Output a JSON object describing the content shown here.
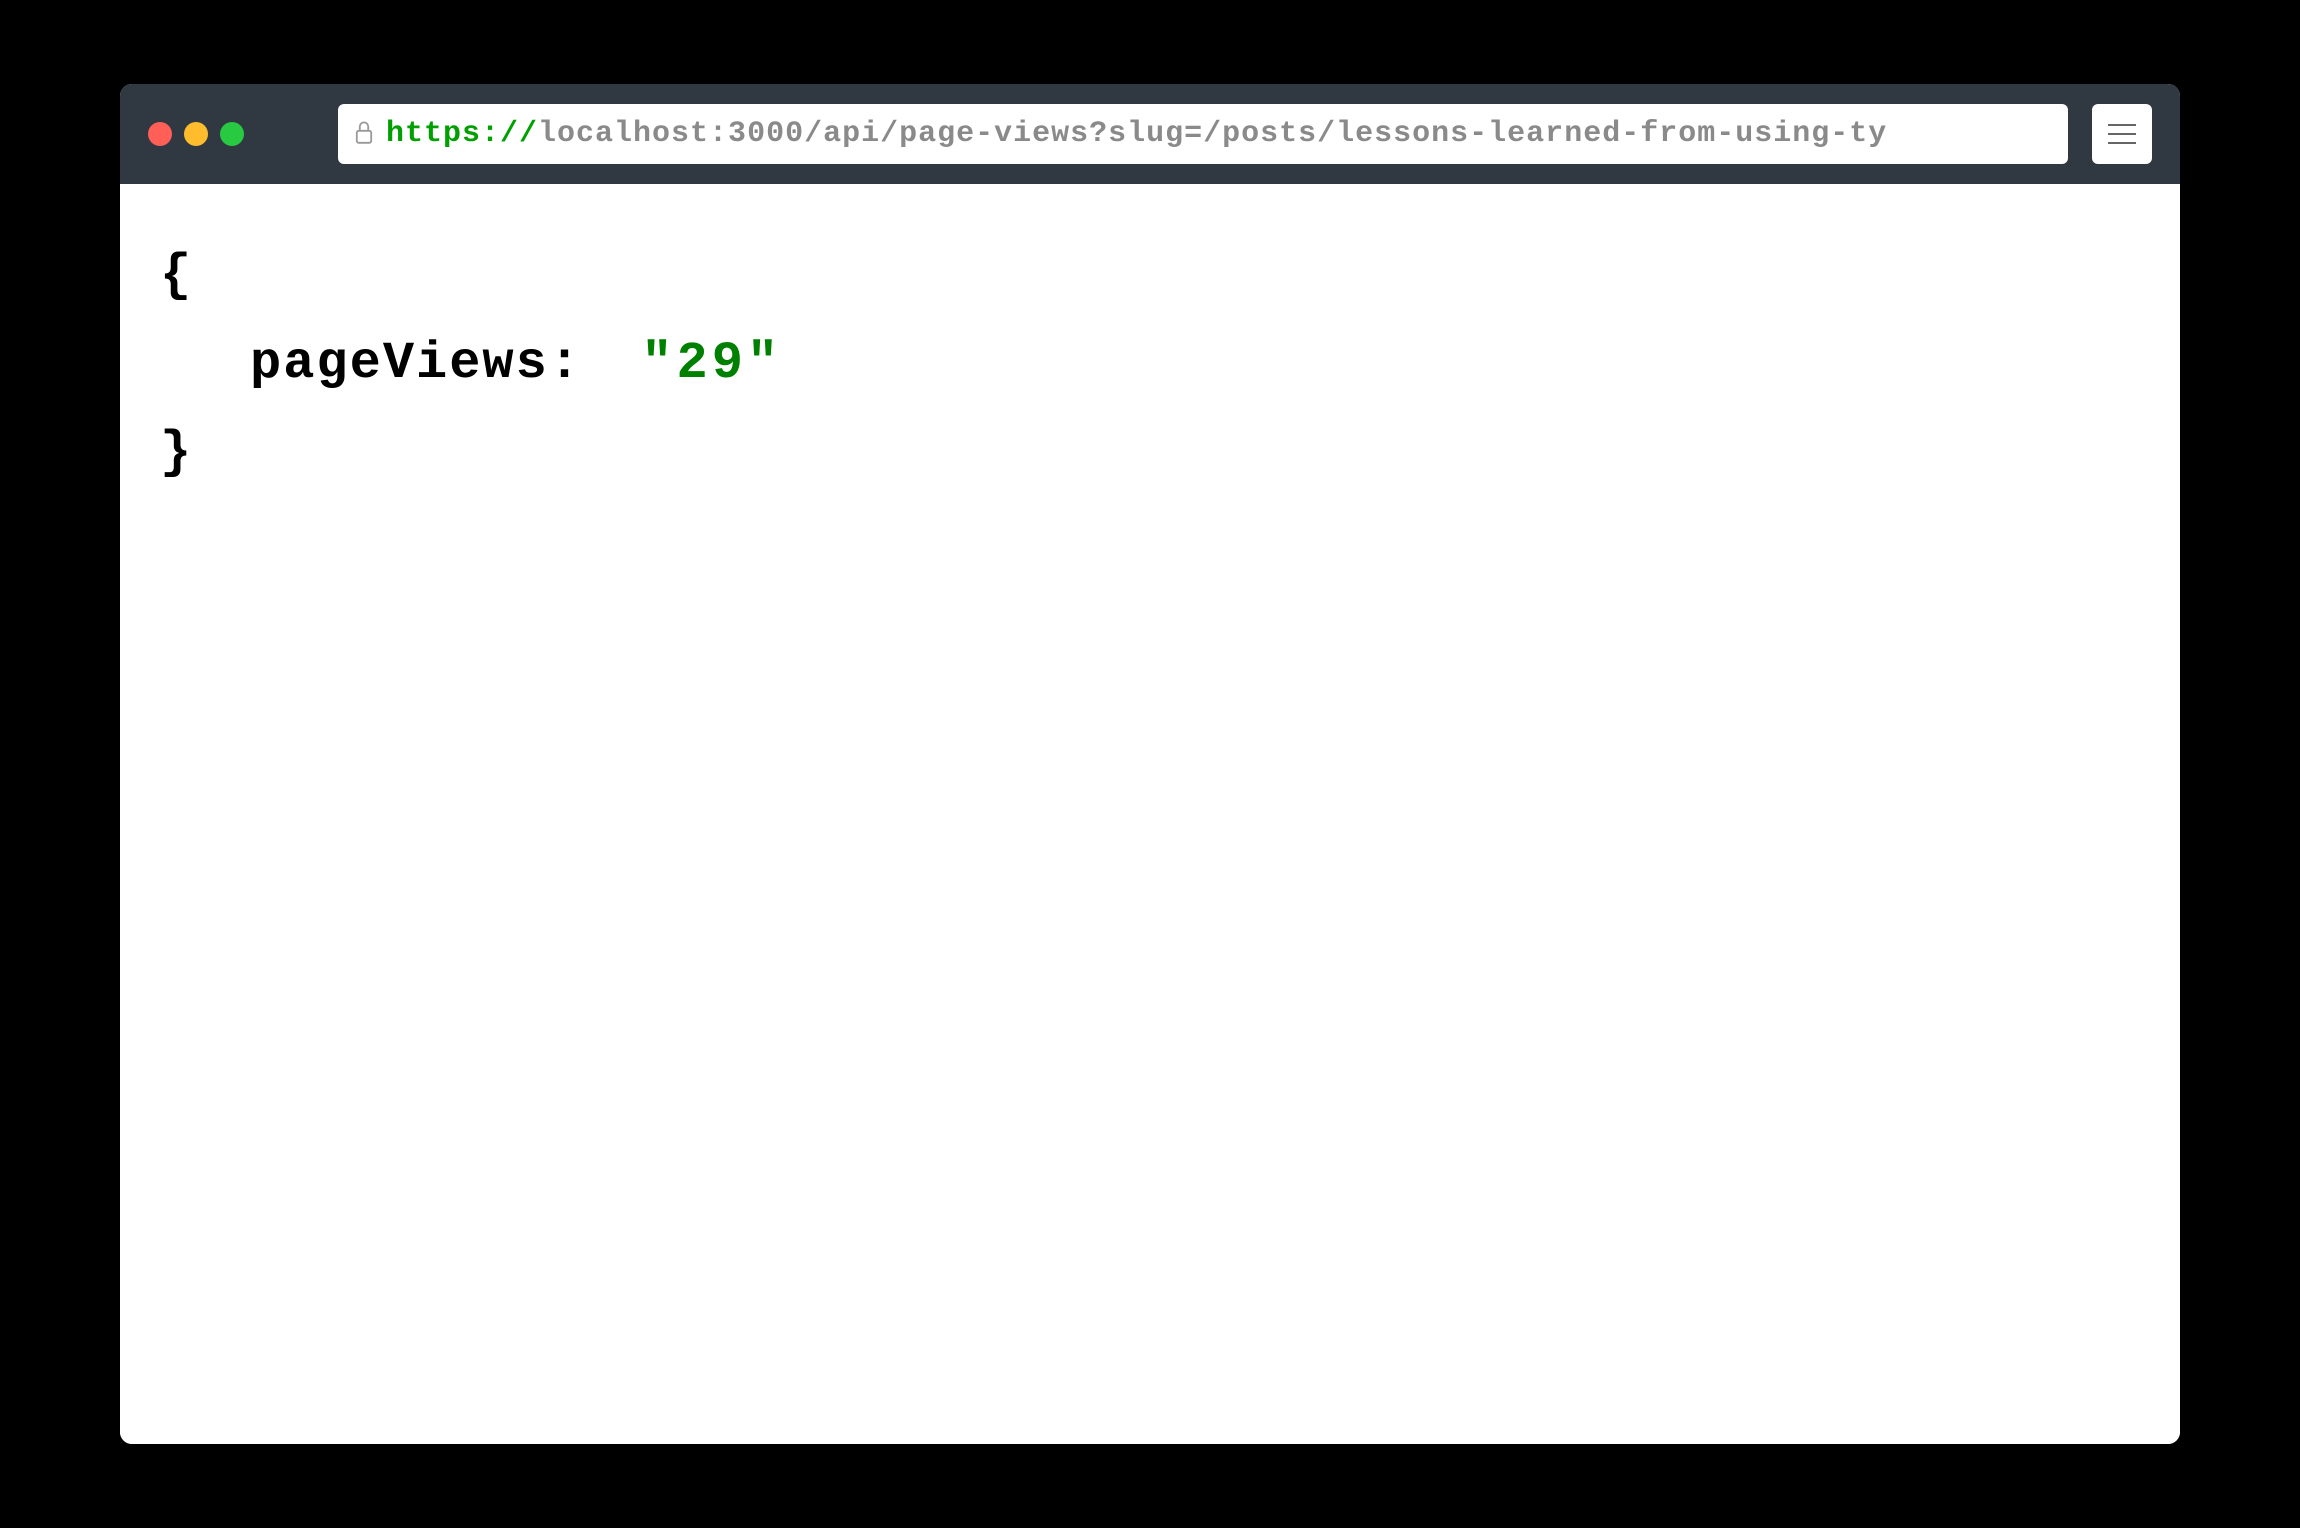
{
  "browser": {
    "url": {
      "protocol": "https://",
      "path": "localhost:3000/api/page-views?slug=/posts/lessons-learned-from-using-ty"
    }
  },
  "content": {
    "json": {
      "open_brace": "{",
      "key": "pageViews:",
      "value": "\"29\"",
      "close_brace": "}"
    }
  }
}
